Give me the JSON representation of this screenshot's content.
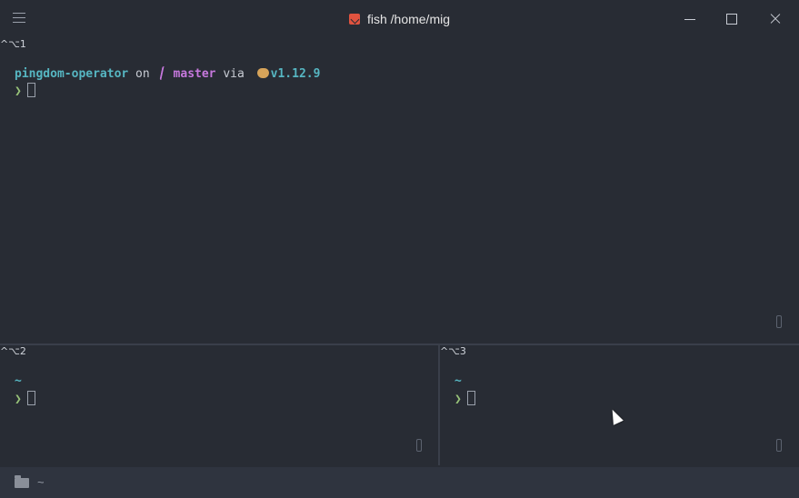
{
  "window": {
    "title": "fish /home/mig",
    "icons": {
      "menu": "hamburger-menu-icon",
      "app": "fish-terminal-icon",
      "minimize": "minimize-icon",
      "maximize": "maximize-icon",
      "close": "close-icon"
    }
  },
  "panes": [
    {
      "label": "^⌥1",
      "prompt": {
        "dir": "pingdom-operator",
        "on": " on ",
        "branch": "master",
        "via": " via ",
        "version": "v1.12.9",
        "symbol": "❯"
      }
    },
    {
      "label": "^⌥2",
      "dir": "~",
      "symbol": "❯"
    },
    {
      "label": "^⌥3",
      "dir": "~",
      "symbol": "❯"
    }
  ],
  "statusbar": {
    "path": "~",
    "icon": "folder-icon"
  },
  "colors": {
    "background": "#282c34",
    "cyan": "#56b6c2",
    "magenta": "#c678dd",
    "green": "#98c379"
  }
}
